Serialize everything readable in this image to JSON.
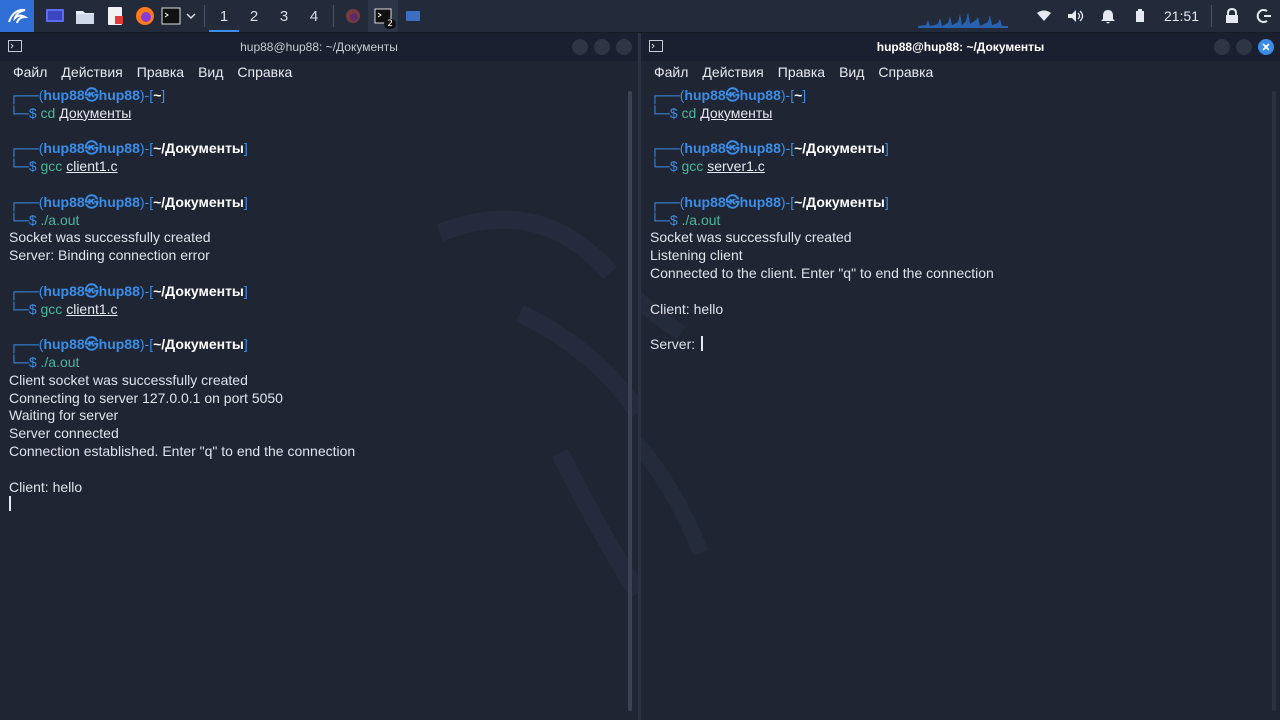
{
  "taskbar": {
    "workspaces": [
      "1",
      "2",
      "3",
      "4"
    ],
    "active_workspace": "1",
    "terminal_badge": "2",
    "clock": "21:51",
    "icons": [
      "kali-menu-icon",
      "desktop-icon",
      "files-icon",
      "text-editor-icon",
      "firefox-icon",
      "terminal-icon",
      "chevron-down-icon"
    ]
  },
  "windows": {
    "left": {
      "title": "hup88@hup88: ~/Документы",
      "menu": [
        "Файл",
        "Действия",
        "Правка",
        "Вид",
        "Справка"
      ],
      "user": "hup88",
      "host": "hup88",
      "lines": {
        "p1_dir": "~",
        "c1_cmd": "cd",
        "c1_arg": "Документы",
        "p2_dir": "~/Документы",
        "c2_cmd": "gcc",
        "c2_arg": "client1.c",
        "p3_dir": "~/Документы",
        "c3_cmd": "./a.out",
        "o1": "Socket was successfully created",
        "o2": "Server: Binding connection error",
        "p4_dir": "~/Документы",
        "c4_cmd": "gcc",
        "c4_arg": "client1.c",
        "p5_dir": "~/Документы",
        "c5_cmd": "./a.out",
        "o3": "Client socket was successfully created",
        "o4": "Connecting to server 127.0.0.1 on port 5050",
        "o5": "Waiting for server",
        "o6": "Server connected",
        "o7": "Connection established. Enter \"q\" to end the connection",
        "o8": "Client: hello"
      }
    },
    "right": {
      "title": "hup88@hup88: ~/Документы",
      "menu": [
        "Файл",
        "Действия",
        "Правка",
        "Вид",
        "Справка"
      ],
      "user": "hup88",
      "host": "hup88",
      "lines": {
        "p1_dir": "~",
        "c1_cmd": "cd",
        "c1_arg": "Документы",
        "p2_dir": "~/Документы",
        "c2_cmd": "gcc",
        "c2_arg": "server1.c",
        "p3_dir": "~/Документы",
        "c3_cmd": "./a.out",
        "o1": "Socket was successfully created",
        "o2": "Listening client",
        "o3": "Connected to the client. Enter \"q\" to end the connection",
        "o4": "Client: hello",
        "o5": "Server: "
      }
    }
  },
  "colors": {
    "prompt_blue": "#3b8ee8",
    "command_green": "#4bb89a",
    "background": "#1f2533"
  }
}
